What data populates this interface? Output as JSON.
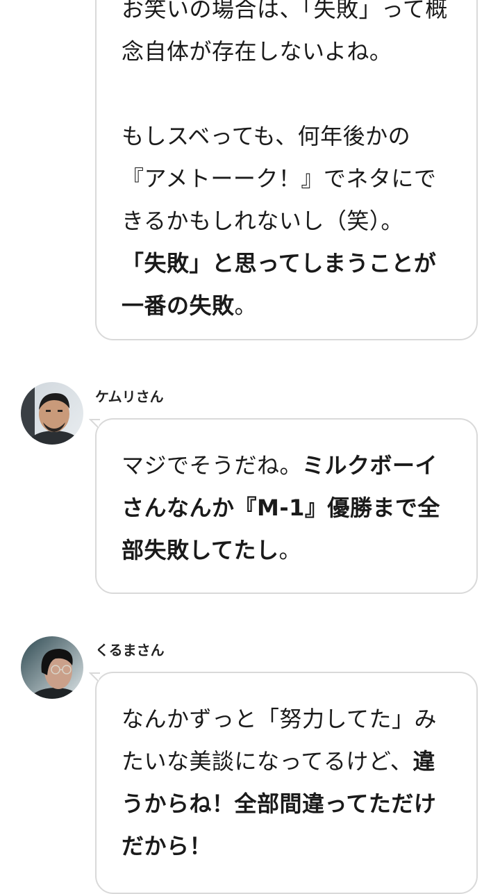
{
  "messages": [
    {
      "speaker": "",
      "lines": [
        [
          {
            "t": "お笑いの場合は、「失敗」って概",
            "b": false
          }
        ],
        [
          {
            "t": "念自体が存在しないよね。",
            "b": false
          }
        ],
        [
          {
            "t": "",
            "b": false
          }
        ],
        [
          {
            "t": "もしスベっても、何年後かの",
            "b": false
          }
        ],
        [
          {
            "t": "『アメトーーク！』でネタにで",
            "b": false
          }
        ],
        [
          {
            "t": "きるかもしれないし（笑）。",
            "b": false
          }
        ],
        [
          {
            "t": "「失敗」と思ってしまうことが",
            "b": true
          }
        ],
        [
          {
            "t": "一番の失敗",
            "b": true
          },
          {
            "t": "。",
            "b": false
          }
        ]
      ]
    },
    {
      "speaker": "ケムリさん",
      "lines": [
        [
          {
            "t": "マジでそうだね。",
            "b": false
          },
          {
            "t": "ミルクボーイ",
            "b": true
          }
        ],
        [
          {
            "t": "さんなんか『M-1』優勝まで全",
            "b": true
          }
        ],
        [
          {
            "t": "部失敗してたし",
            "b": true
          },
          {
            "t": "。",
            "b": false
          }
        ]
      ]
    },
    {
      "speaker": "くるまさん",
      "lines": [
        [
          {
            "t": "なんかずっと「努力してた」み",
            "b": false
          }
        ],
        [
          {
            "t": "たいな美談になってるけど、",
            "b": false
          },
          {
            "t": "違",
            "b": true
          }
        ],
        [
          {
            "t": "うからね！全部間違ってただけ",
            "b": true
          }
        ],
        [
          {
            "t": "だから！",
            "b": true
          }
        ]
      ]
    }
  ]
}
